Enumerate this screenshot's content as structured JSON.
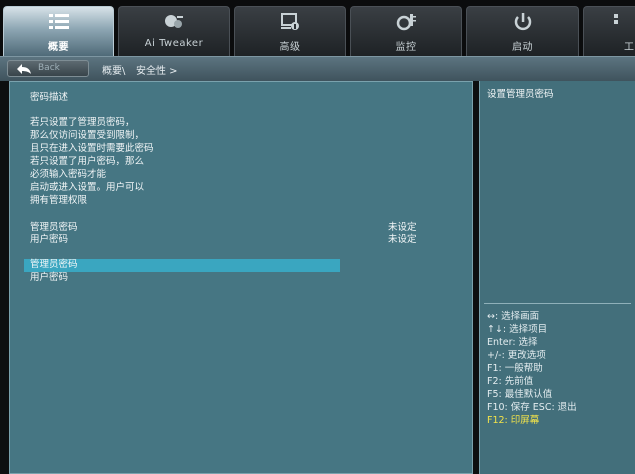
{
  "tabs": [
    {
      "label": "概要",
      "icon": "list-icon",
      "active": true
    },
    {
      "label": "Ai Tweaker",
      "icon": "tweaker-icon",
      "active": false
    },
    {
      "label": "高级",
      "icon": "advanced-icon",
      "active": false
    },
    {
      "label": "监控",
      "icon": "monitor-icon",
      "active": false
    },
    {
      "label": "启动",
      "icon": "power-icon",
      "active": false
    },
    {
      "label": "工",
      "icon": "tool-icon",
      "active": false
    }
  ],
  "breadcrumb": {
    "back_label": "Back",
    "path": "概要\\",
    "current": "安全性 >"
  },
  "main": {
    "heading": "密码描述",
    "description": [
      "若只设置了管理员密码，",
      "那么仅访问设置受到限制，",
      "且只在进入设置时需要此密码",
      "若只设置了用户密码，那么",
      "必须输入密码才能",
      "启动或进入设置。用户可以",
      "拥有管理权限"
    ],
    "status_rows": [
      {
        "label": "管理员密码",
        "value": "未设定"
      },
      {
        "label": "用户密码",
        "value": "未设定"
      }
    ],
    "actions": [
      {
        "label": "管理员密码",
        "selected": true
      },
      {
        "label": "用户密码",
        "selected": false
      }
    ]
  },
  "help": {
    "text": "设置管理员密码",
    "keys": [
      {
        "text": "↔: 选择画面",
        "highlight": false
      },
      {
        "text": "↑↓: 选择项目",
        "highlight": false
      },
      {
        "text": "Enter: 选择",
        "highlight": false
      },
      {
        "text": "+/-: 更改选项",
        "highlight": false
      },
      {
        "text": "F1: 一般帮助",
        "highlight": false
      },
      {
        "text": "F2: 先前值",
        "highlight": false
      },
      {
        "text": "F5: 最佳默认值",
        "highlight": false
      },
      {
        "text": "F10: 保存  ESC: 退出",
        "highlight": false
      },
      {
        "text": "F12: 印屏幕",
        "highlight": true
      }
    ]
  },
  "colors": {
    "panel_bg": "#467683",
    "selection": "#3aa6c0",
    "highlight_key": "#f2e34a"
  }
}
